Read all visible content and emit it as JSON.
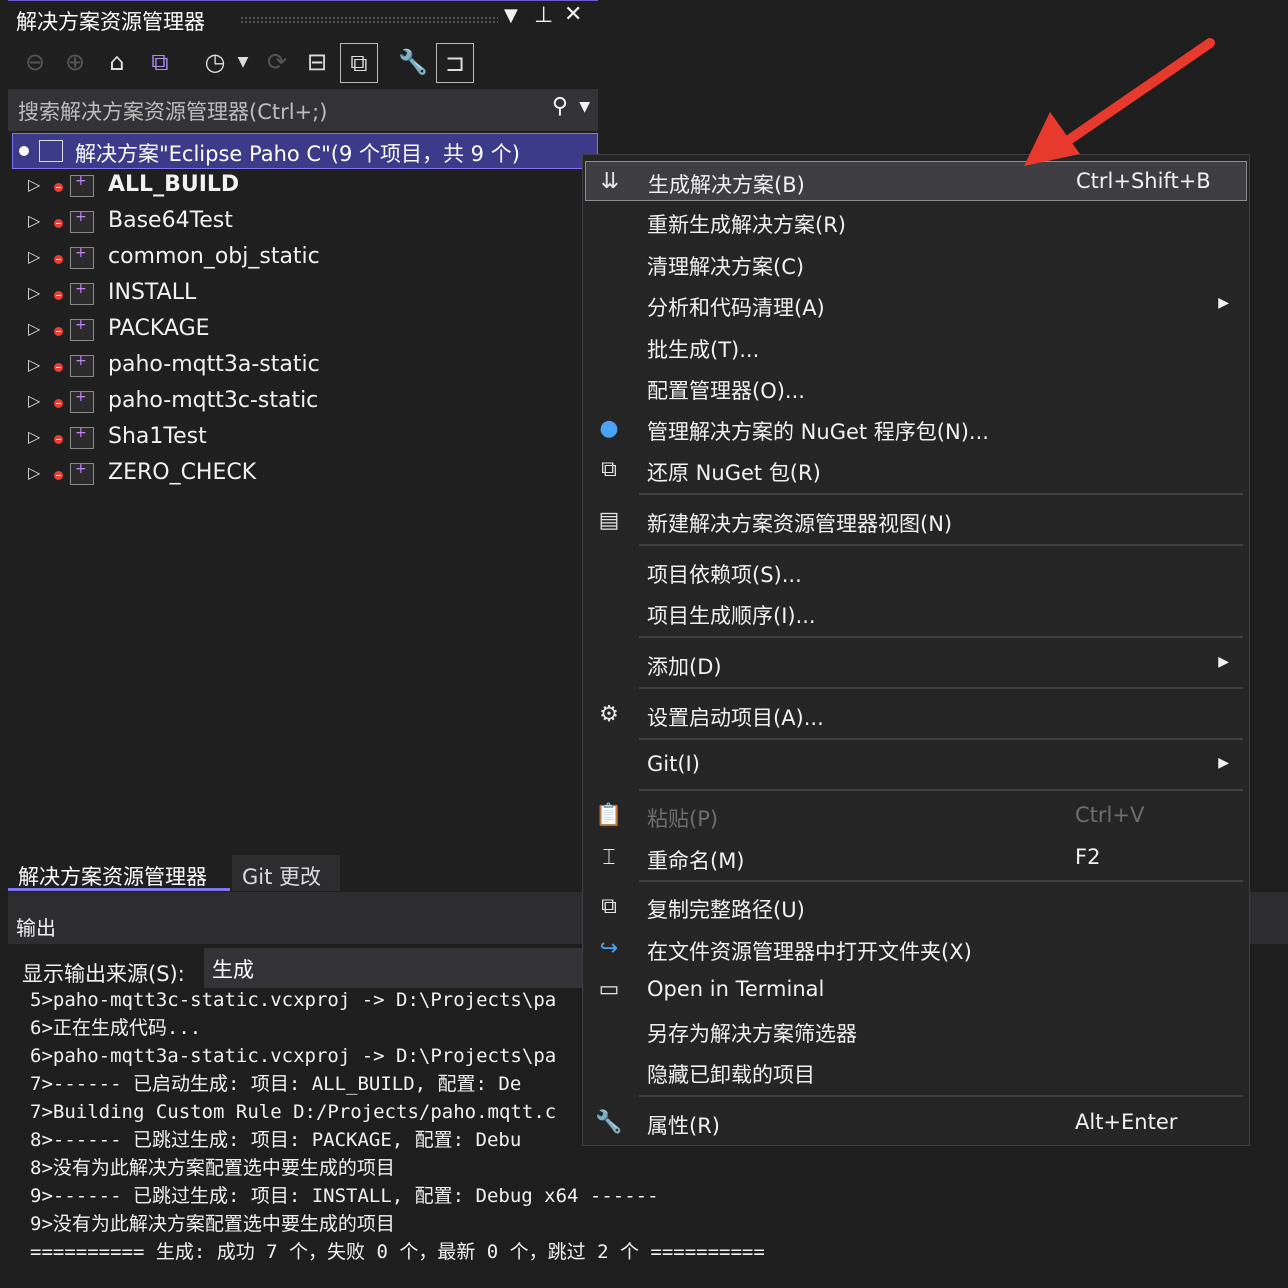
{
  "solution_explorer": {
    "title": "解决方案资源管理器",
    "search_placeholder": "搜索解决方案资源管理器(Ctrl+;)",
    "solution_label": "解决方案\"Eclipse Paho C\"(9 个项目，共 9 个)",
    "projects": [
      {
        "name": "ALL_BUILD"
      },
      {
        "name": "Base64Test"
      },
      {
        "name": "common_obj_static"
      },
      {
        "name": "INSTALL"
      },
      {
        "name": "PACKAGE"
      },
      {
        "name": "paho-mqtt3a-static"
      },
      {
        "name": "paho-mqtt3c-static"
      },
      {
        "name": "Sha1Test"
      },
      {
        "name": "ZERO_CHECK"
      }
    ],
    "tabs": [
      "解决方案资源管理器",
      "Git 更改"
    ]
  },
  "output": {
    "title": "输出",
    "source_label": "显示输出来源(S):",
    "source_value": "生成",
    "lines": [
      "5>paho-mqtt3c-static.vcxproj -> D:\\Projects\\pa",
      "6>正在生成代码...",
      "6>paho-mqtt3a-static.vcxproj -> D:\\Projects\\pa",
      "7>------ 已启动生成: 项目: ALL_BUILD, 配置: De",
      "7>Building Custom Rule D:/Projects/paho.mqtt.c",
      "8>------ 已跳过生成: 项目: PACKAGE, 配置: Debu",
      "8>没有为此解决方案配置选中要生成的项目",
      "9>------ 已跳过生成: 项目: INSTALL, 配置: Debug x64 ------",
      "9>没有为此解决方案配置选中要生成的项目",
      "========== 生成: 成功 7 个，失败 0 个，最新 0 个，跳过 2 个 =========="
    ]
  },
  "context_menu": {
    "items": [
      {
        "label": "生成解决方案(B)",
        "shortcut": "Ctrl+Shift+B"
      },
      {
        "label": "重新生成解决方案(R)"
      },
      {
        "label": "清理解决方案(C)"
      },
      {
        "label": "分析和代码清理(A)"
      },
      {
        "label": "批生成(T)..."
      },
      {
        "label": "配置管理器(O)..."
      },
      {
        "label": "管理解决方案的 NuGet 程序包(N)..."
      },
      {
        "label": "还原 NuGet 包(R)"
      },
      {
        "label": "新建解决方案资源管理器视图(N)"
      },
      {
        "label": "项目依赖项(S)..."
      },
      {
        "label": "项目生成顺序(I)..."
      },
      {
        "label": "添加(D)"
      },
      {
        "label": "设置启动项目(A)..."
      },
      {
        "label": "Git(I)"
      },
      {
        "label": "粘贴(P)",
        "shortcut": "Ctrl+V"
      },
      {
        "label": "重命名(M)",
        "shortcut": "F2"
      },
      {
        "label": "复制完整路径(U)"
      },
      {
        "label": "在文件资源管理器中打开文件夹(X)"
      },
      {
        "label": "Open in Terminal"
      },
      {
        "label": "另存为解决方案筛选器"
      },
      {
        "label": "隐藏已卸载的项目"
      },
      {
        "label": "属性(R)",
        "shortcut": "Alt+Enter"
      }
    ]
  },
  "colors": {
    "accent": "#7e74f0",
    "annotation_arrow": "#e8392d",
    "error_dot": "#e5403a"
  }
}
